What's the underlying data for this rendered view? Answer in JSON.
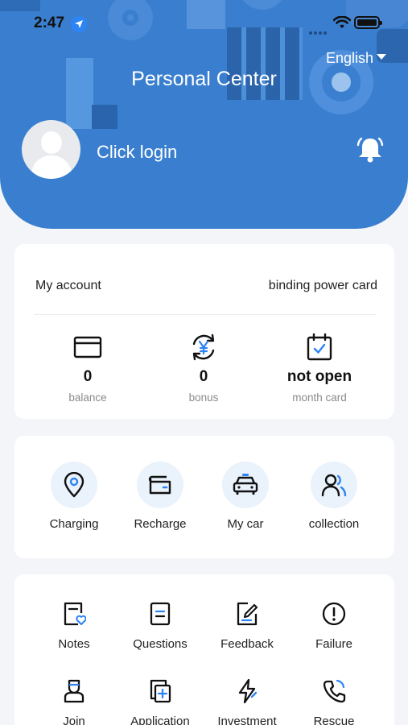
{
  "status_bar": {
    "time": "2:47"
  },
  "header": {
    "language": "English",
    "title": "Personal Center",
    "login_text": "Click login"
  },
  "account": {
    "label": "My account",
    "bind_label": "binding power card",
    "stats": [
      {
        "value": "0",
        "caption": "balance",
        "icon": "card-icon"
      },
      {
        "value": "0",
        "caption": "bonus",
        "icon": "yen-refresh-icon"
      },
      {
        "value": "not open",
        "caption": "month card",
        "icon": "calendar-check-icon"
      }
    ]
  },
  "services": [
    {
      "label": "Charging",
      "icon": "location-pin-icon"
    },
    {
      "label": "Recharge",
      "icon": "wallet-icon"
    },
    {
      "label": "My car",
      "icon": "car-icon"
    },
    {
      "label": "collection",
      "icon": "users-icon"
    }
  ],
  "more": [
    {
      "label": "Notes",
      "icon": "note-heart-icon"
    },
    {
      "label": "Questions",
      "icon": "document-icon"
    },
    {
      "label": "Feedback",
      "icon": "edit-icon"
    },
    {
      "label": "Failure",
      "icon": "alert-circle-icon"
    },
    {
      "label": "Join",
      "icon": "person-badge-icon"
    },
    {
      "label": "Application",
      "icon": "add-doc-icon"
    },
    {
      "label": "Investment",
      "icon": "lightning-icon"
    },
    {
      "label": "Rescue",
      "icon": "phone-icon"
    }
  ],
  "colors": {
    "brand": "#3a7fcf",
    "accent": "#2d84f5",
    "background": "#f3f5f8"
  }
}
